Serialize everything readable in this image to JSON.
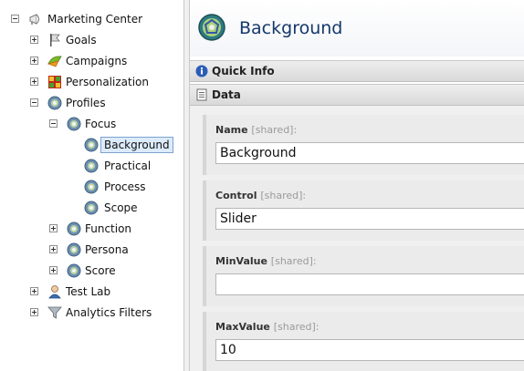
{
  "tree": {
    "marketing_center": "Marketing Center",
    "goals": "Goals",
    "campaigns": "Campaigns",
    "personalization": "Personalization",
    "profiles": "Profiles",
    "focus": "Focus",
    "background": "Background",
    "practical": "Practical",
    "process": "Process",
    "scope": "Scope",
    "function": "Function",
    "persona": "Persona",
    "score": "Score",
    "test_lab": "Test Lab",
    "analytics_filters": "Analytics Filters"
  },
  "header": {
    "title": "Background"
  },
  "sections": {
    "quick_info": "Quick Info",
    "data": "Data"
  },
  "fields": [
    {
      "label": "Name",
      "shared": "[shared]:",
      "value": "Background"
    },
    {
      "label": "Control",
      "shared": "[shared]:",
      "value": "Slider"
    },
    {
      "label": "MinValue",
      "shared": "[shared]:",
      "value": ""
    },
    {
      "label": "MaxValue",
      "shared": "[shared]:",
      "value": "10"
    }
  ],
  "colors": {
    "accent": "#14386b",
    "selection": "#dcebfc"
  }
}
